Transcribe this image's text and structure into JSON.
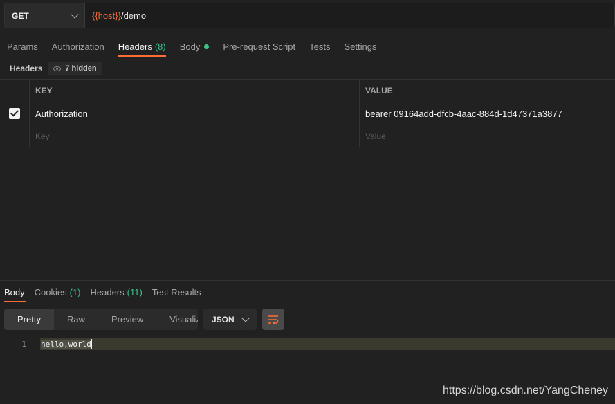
{
  "request": {
    "method": "GET",
    "url_var": "{{host}}",
    "url_path": "/demo"
  },
  "request_tabs": [
    {
      "label": "Params"
    },
    {
      "label": "Authorization"
    },
    {
      "label": "Headers",
      "count": "(8)"
    },
    {
      "label": "Body"
    },
    {
      "label": "Pre-request Script"
    },
    {
      "label": "Tests"
    },
    {
      "label": "Settings"
    }
  ],
  "headers_bar": {
    "title": "Headers",
    "hidden_label": "7 hidden"
  },
  "table": {
    "key_header": "KEY",
    "value_header": "VALUE",
    "rows": [
      {
        "key": "Authorization",
        "value": "bearer 09164add-dfcb-4aac-884d-1d47371a3877",
        "checked": true
      }
    ],
    "key_placeholder": "Key",
    "value_placeholder": "Value"
  },
  "response_tabs": [
    {
      "label": "Body"
    },
    {
      "label": "Cookies",
      "count": "(1)"
    },
    {
      "label": "Headers",
      "count": "(11)"
    },
    {
      "label": "Test Results"
    }
  ],
  "response_views": [
    "Pretty",
    "Raw",
    "Preview",
    "Visualize"
  ],
  "format": "JSON",
  "code": {
    "line_number": "1",
    "text": "hello,world"
  },
  "watermark": "https://blog.csdn.net/YangCheney",
  "colors": {
    "accent": "#ff6c37",
    "count_green": "#3bc48a",
    "variable_orange": "#e86a3a"
  }
}
